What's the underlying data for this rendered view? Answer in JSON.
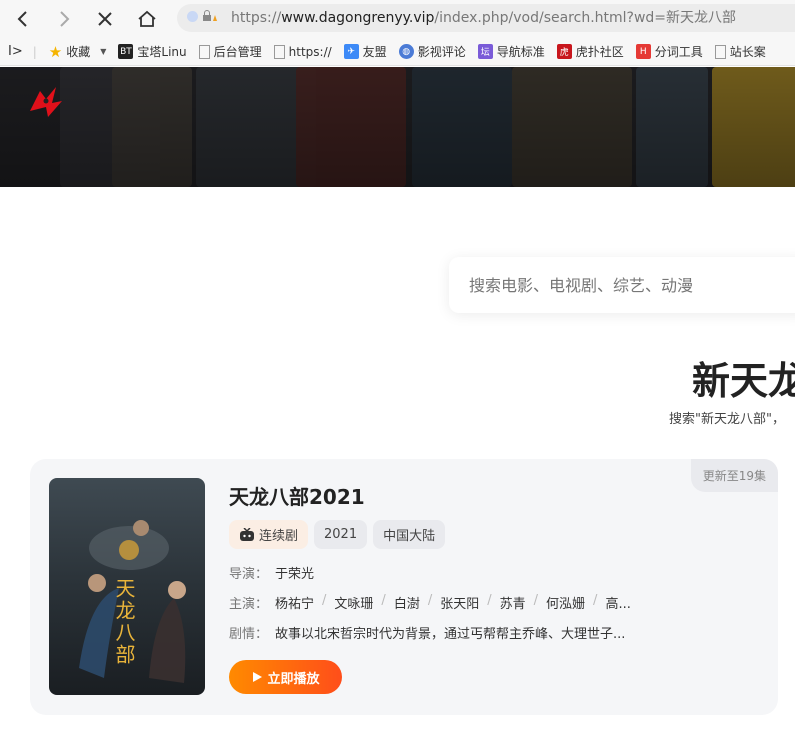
{
  "browser": {
    "url_prefix": "https://",
    "url_domain": "www.dagongrenyy.vip",
    "url_path": "/index.php/vod/search.html?wd=新天龙八部"
  },
  "bookmarks": [
    {
      "label": "收藏",
      "icon": "star-icon",
      "color": "#f5b400"
    },
    {
      "label": "宝塔Linu",
      "icon": "bt-icon",
      "color": "#222222",
      "glyph": "BT"
    },
    {
      "label": "后台管理",
      "icon": "page-icon",
      "color": "#999999"
    },
    {
      "label": "https://",
      "icon": "page-icon",
      "color": "#999999"
    },
    {
      "label": "友盟",
      "icon": "umeng-icon",
      "color": "#3d8af7",
      "glyph": "友"
    },
    {
      "label": "影视评论",
      "icon": "globe-icon",
      "color": "#4b7bd6",
      "glyph": "◍"
    },
    {
      "label": "导航标准",
      "icon": "forum-icon",
      "color": "#7a5bd8",
      "glyph": "坛"
    },
    {
      "label": "虎扑社区",
      "icon": "hupu-icon",
      "color": "#c8161d",
      "glyph": "虎"
    },
    {
      "label": "分词工具",
      "icon": "tool-icon",
      "color": "#e53935",
      "glyph": "H"
    },
    {
      "label": "站长案",
      "icon": "page-icon",
      "color": "#999999"
    }
  ],
  "search": {
    "placeholder": "搜索电影、电视剧、综艺、动漫"
  },
  "heading": {
    "title": "新天龙",
    "subtitle": "搜索\"新天龙八部\"，"
  },
  "result": {
    "update_badge": "更新至19集",
    "title": "天龙八部2021",
    "type_tag": "连续剧",
    "year_tag": "2021",
    "region_tag": "中国大陆",
    "director_label": "导演：",
    "director": "于荣光",
    "cast_label": "主演：",
    "cast": [
      "杨祐宁",
      "文咏珊",
      "白澍",
      "张天阳",
      "苏青",
      "何泓姗",
      "高..."
    ],
    "plot_label": "剧情：",
    "plot": "故事以北宋哲宗时代为背景，通过丐帮帮主乔峰、大理世子...",
    "poster_text": "天龙八部",
    "play_button": "立即播放"
  },
  "colors": {
    "accent_start": "#ff8a00",
    "accent_end": "#ff4e1a"
  }
}
